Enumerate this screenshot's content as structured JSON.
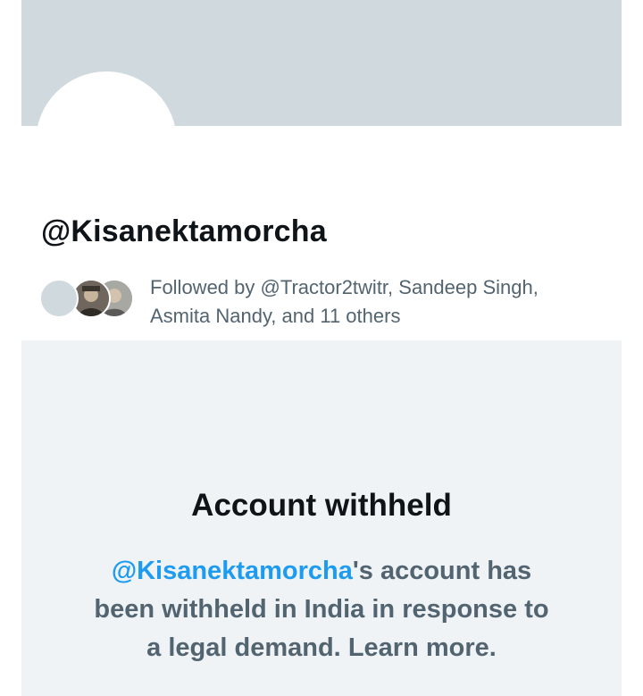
{
  "profile": {
    "handle": "@Kisanektamorcha"
  },
  "followed_by": {
    "line1": "Followed by @Tractor2twitr, Sandeep Singh,",
    "line2": "Asmita Nandy, and 11 others"
  },
  "withheld": {
    "title": "Account withheld",
    "mention": "@Kisanektamorcha",
    "line1_rest": "'s account has",
    "line2": "been withheld in India in response to",
    "line3_prefix": "a legal demand. ",
    "learn_more": "Learn more."
  },
  "colors": {
    "banner": "#cfd9de",
    "link": "#1d9bf0",
    "panel": "#eff3f6",
    "secondary_text": "#536471"
  }
}
